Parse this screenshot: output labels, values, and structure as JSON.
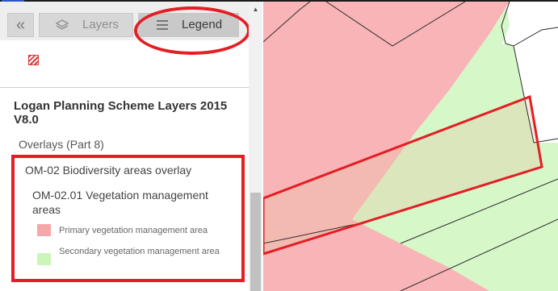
{
  "toolbar": {
    "collapse_glyph": "«",
    "layers_tab_label": "Layers",
    "legend_tab_label": "Legend",
    "layers_icon": "layers-icon",
    "legend_icon": "list-icon"
  },
  "legend": {
    "scheme_title": "Logan Planning Scheme Layers 2015 V8.0",
    "group_label": "Overlays (Part 8)",
    "overlay_title": "OM-02 Biodiversity areas overlay",
    "sublayer_title": "OM-02.01 Vegetation management areas",
    "items": [
      {
        "label": "Primary vegetation management area",
        "color": "#f6a7aa"
      },
      {
        "label": "Secondary vegetation management area",
        "color": "#ccf6b8"
      }
    ]
  },
  "colors": {
    "annotation_red": "#e31e24",
    "hatch_red": "#d93a3a",
    "map_pink": "#f8b4b6",
    "map_green": "#d6f7c8"
  }
}
